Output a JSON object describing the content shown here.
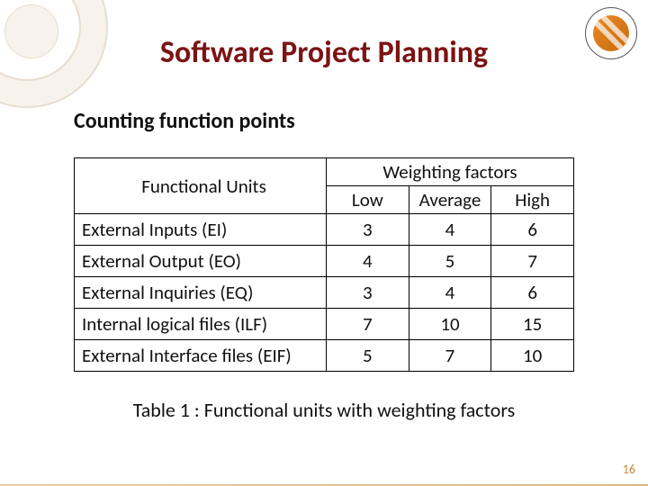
{
  "title": "Software Project Planning",
  "subtitle": "Counting function points",
  "table": {
    "header_functional_units": "Functional Units",
    "header_weighting": "Weighting factors",
    "col_low": "Low",
    "col_avg": "Average",
    "col_high": "High",
    "rows": [
      {
        "name": "External Inputs (EI)",
        "low": "3",
        "avg": "4",
        "high": "6"
      },
      {
        "name": "External Output (EO)",
        "low": "4",
        "avg": "5",
        "high": "7"
      },
      {
        "name": "External Inquiries (EQ)",
        "low": "3",
        "avg": "4",
        "high": "6"
      },
      {
        "name": "Internal logical files (ILF)",
        "low": "7",
        "avg": "10",
        "high": "15"
      },
      {
        "name": "External Interface files (EIF)",
        "low": "5",
        "avg": "7",
        "high": "10"
      }
    ]
  },
  "caption": "Table 1 : Functional units with weighting factors",
  "page_number": "16",
  "chart_data": {
    "type": "table",
    "title": "Functional units with weighting factors",
    "columns": [
      "Functional Units",
      "Low",
      "Average",
      "High"
    ],
    "rows": [
      [
        "External Inputs (EI)",
        3,
        4,
        6
      ],
      [
        "External Output (EO)",
        4,
        5,
        7
      ],
      [
        "External Inquiries (EQ)",
        3,
        4,
        6
      ],
      [
        "Internal logical files (ILF)",
        7,
        10,
        15
      ],
      [
        "External Interface files (EIF)",
        5,
        7,
        10
      ]
    ]
  }
}
